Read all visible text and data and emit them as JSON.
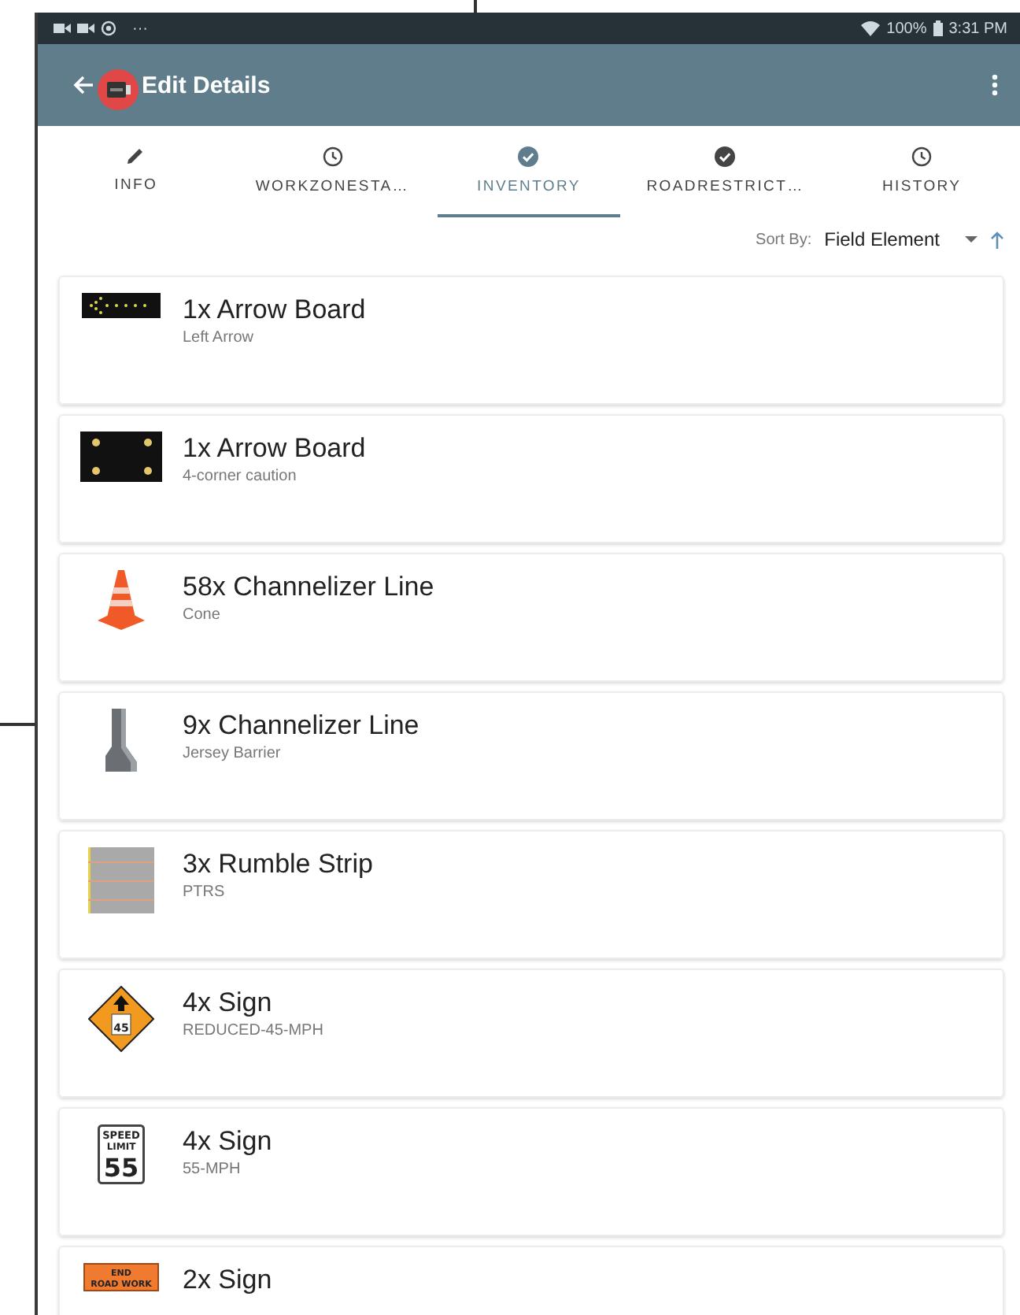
{
  "status_bar": {
    "more": "···",
    "battery": "100%",
    "time": "3:31 PM"
  },
  "app_bar": {
    "title": "Edit Details"
  },
  "tabs": [
    {
      "label": "INFO",
      "selected": false
    },
    {
      "label": "WORKZONESTA…",
      "selected": false
    },
    {
      "label": "INVENTORY",
      "selected": true
    },
    {
      "label": "ROADRESTRICT…",
      "selected": false
    },
    {
      "label": "HISTORY",
      "selected": false
    }
  ],
  "sort": {
    "label": "Sort By:",
    "value": "Field Element"
  },
  "items": [
    {
      "title": "1x Arrow Board",
      "subtitle": "Left Arrow",
      "kind": "arrow-board"
    },
    {
      "title": "1x Arrow Board",
      "subtitle": "4-corner caution",
      "kind": "caution-board"
    },
    {
      "title": "58x Channelizer Line",
      "subtitle": "Cone",
      "kind": "cone"
    },
    {
      "title": "9x Channelizer Line",
      "subtitle": "Jersey Barrier",
      "kind": "barrier"
    },
    {
      "title": "3x Rumble Strip",
      "subtitle": "PTRS",
      "kind": "rumble"
    },
    {
      "title": "4x Sign",
      "subtitle": "REDUCED-45-MPH",
      "kind": "diamond-sign",
      "sign_text": [
        "45"
      ]
    },
    {
      "title": "4x Sign",
      "subtitle": "55-MPH",
      "kind": "speed-sign",
      "sign_text": [
        "SPEED",
        "LIMIT",
        "55"
      ]
    },
    {
      "title": "2x Sign",
      "kind": "road-work-sign",
      "sign_text": [
        "END",
        "ROAD WORK"
      ]
    }
  ]
}
